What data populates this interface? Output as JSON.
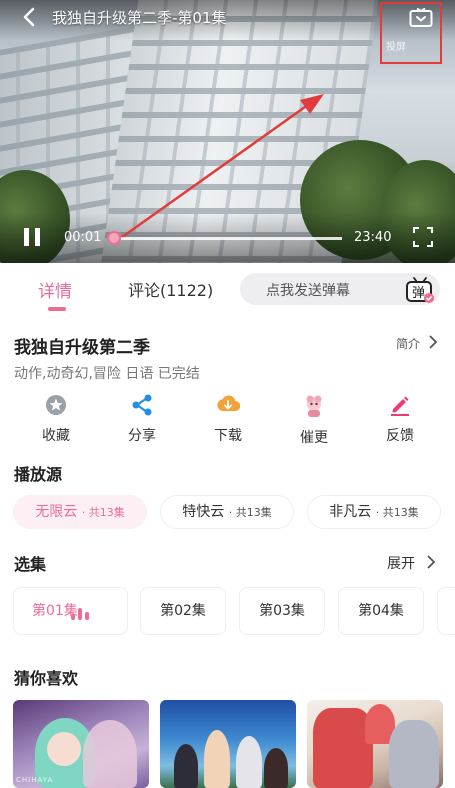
{
  "player": {
    "title": "我独自升级第二季-第01集",
    "current_time": "00:01",
    "total_time": "23:40",
    "progress": 0.01,
    "tv_caption": "投屏"
  },
  "tabs": {
    "details": "详情",
    "comments": "评论(1122)",
    "danmaku_placeholder": "点我发送弹幕",
    "danmaku_icon_text": "弹"
  },
  "anime": {
    "title": "我独自升级第二季",
    "intro_label": "简介",
    "tags": "动作,动奇幻,冒险 日语 已完结"
  },
  "actions": [
    {
      "label": "收藏",
      "icon": "star-icon"
    },
    {
      "label": "分享",
      "icon": "share-icon"
    },
    {
      "label": "下载",
      "icon": "download-icon"
    },
    {
      "label": "催更",
      "icon": "urge-icon"
    },
    {
      "label": "反馈",
      "icon": "pencil-icon"
    }
  ],
  "sources": {
    "title": "播放源",
    "items": [
      {
        "name": "无限云",
        "count": "· 共13集",
        "active": true
      },
      {
        "name": "特快云",
        "count": "· 共13集",
        "active": false
      },
      {
        "name": "非凡云",
        "count": "· 共13集",
        "active": false
      }
    ]
  },
  "episodes": {
    "title": "选集",
    "expand_label": "展开",
    "items": [
      "第01集",
      "第02集",
      "第03集",
      "第04集"
    ]
  },
  "recommend": {
    "title": "猜你喜欢",
    "cover1_caption": "CHIHAYA"
  },
  "colors": {
    "accent": "#f06b94",
    "annotation": "#e23b3b"
  }
}
